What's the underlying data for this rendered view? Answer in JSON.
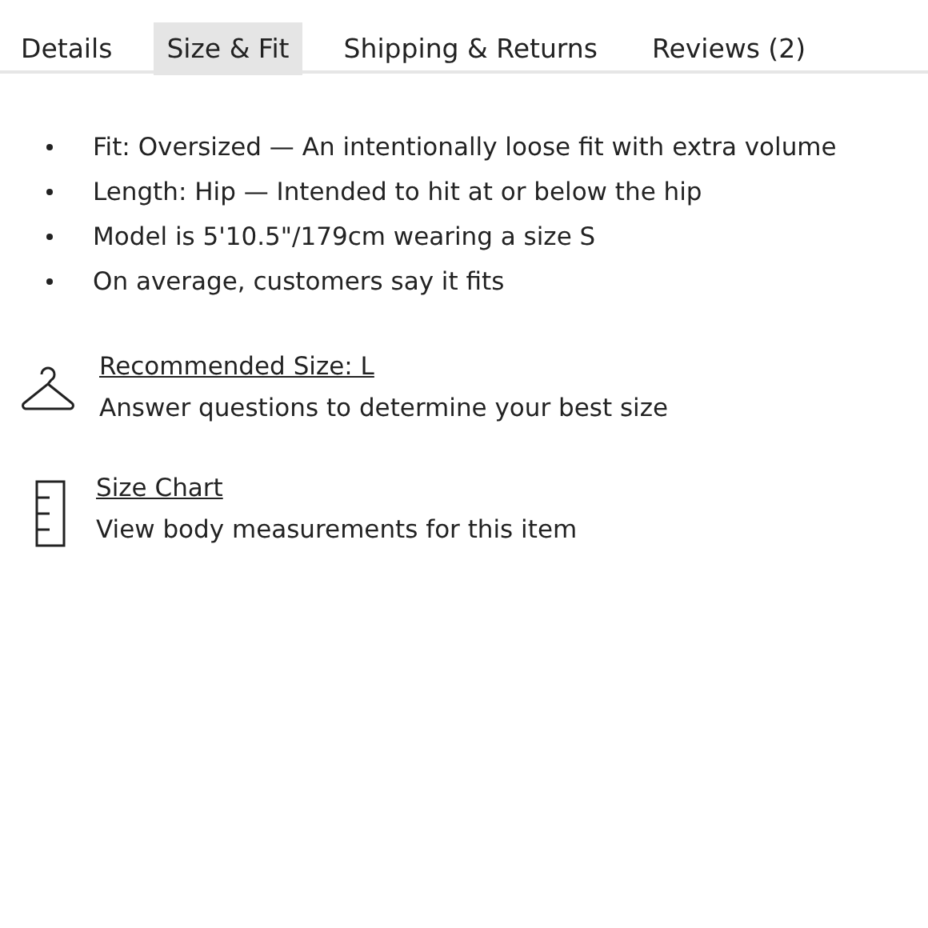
{
  "tabs": [
    {
      "label": "Details",
      "selected": false
    },
    {
      "label": "Size & Fit",
      "selected": true
    },
    {
      "label": "Shipping & Returns",
      "selected": false
    },
    {
      "label": "Reviews (2)",
      "selected": false
    }
  ],
  "fit_notes": [
    "Fit: Oversized — An intentionally loose fit with extra volume",
    "Length: Hip — Intended to hit at or below the hip",
    "Model is 5'10.5\"/179cm wearing a size S",
    "On average, customers say it fits"
  ],
  "size_links": [
    {
      "kind": "hanger",
      "title": "Recommended Size: L",
      "description": "Answer questions to determine your best size"
    },
    {
      "kind": "ruler",
      "title": "Size Chart",
      "description": "View body measurements for this item"
    }
  ]
}
